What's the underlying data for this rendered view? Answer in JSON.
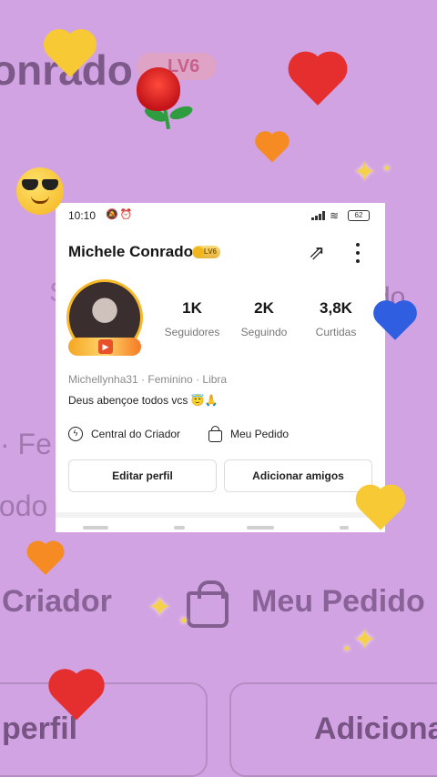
{
  "status_bar": {
    "time": "10:10",
    "status_icons": "🔕⏰",
    "battery": "62"
  },
  "profile": {
    "name": "Michele Conrado",
    "level_badge": "LV6",
    "share_icon": "share-arrow-icon",
    "more_icon": "more-vertical-icon",
    "stats": [
      {
        "value": "1K",
        "label": "Seguidores"
      },
      {
        "value": "2K",
        "label": "Seguindo"
      },
      {
        "value": "3,8K",
        "label": "Curtidas"
      }
    ],
    "meta": "Michellynha31 · Feminino · Libra",
    "bio": "Deus abençoe todos vcs 😇🙏",
    "creator_center_label": "Central do Criador",
    "my_order_label": "Meu Pedido",
    "edit_profile_label": "Editar perfil",
    "add_friends_label": "Adicionar amigos"
  },
  "background_echo": {
    "name_fragment": "onrado",
    "badge": "LV6",
    "do_fragment": "do",
    "s_fragment": "S",
    "fe_fragment": "·  Fe",
    "todo_fragment": "todo",
    "criador_fragment": "Criador",
    "pedido": "Meu Pedido",
    "perfil_fragment": "perfil",
    "adiciona_fragment": "Adiciona"
  },
  "colors": {
    "background": "#d2a3e2",
    "accent_gold": "#f7b928",
    "heart_red": "#e52f2f",
    "heart_orange": "#f58b22",
    "heart_yellow": "#f7c934",
    "heart_blue": "#2f5fe0"
  }
}
